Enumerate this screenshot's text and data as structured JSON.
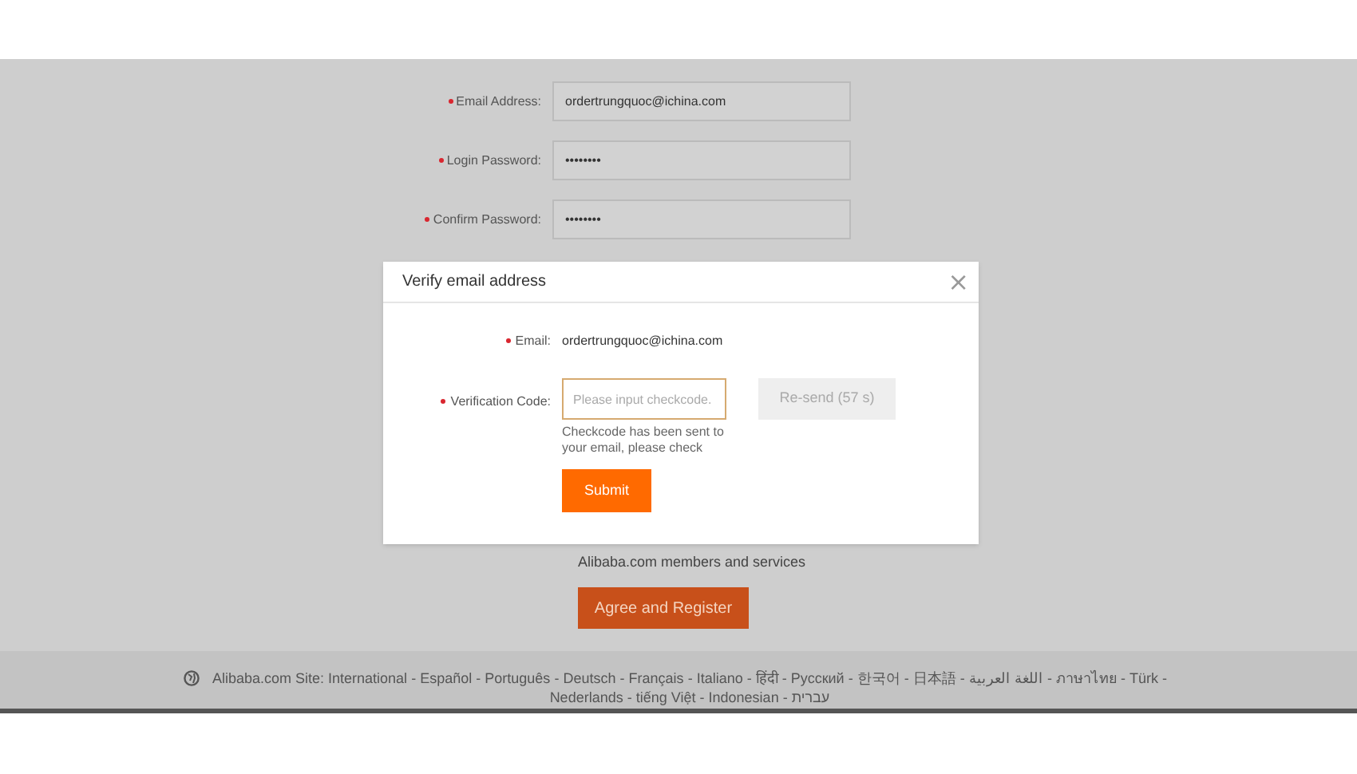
{
  "form": {
    "fields": [
      {
        "label": "Email Address:",
        "required": true,
        "value": "ordertrungquoc@ichina.com"
      },
      {
        "label": "Login Password:",
        "required": true,
        "value": "••••••••"
      },
      {
        "label": "Confirm Password:",
        "required": true,
        "value": "••••••••"
      }
    ],
    "agreement_text": "Alibaba.com members and services",
    "register_button": "Agree and Register"
  },
  "dialog": {
    "title": "Verify email address",
    "close": "×",
    "email": {
      "label": "Email:",
      "required": true,
      "value": "ordertrungquoc@ichina.com"
    },
    "code": {
      "label": "Verification Code:",
      "required": true,
      "placeholder": "Please input checkcode.",
      "hint": "Checkcode has been sent to your email, please check",
      "resend_button": "Re-send (57 s)",
      "resend_disabled": true
    },
    "submit_button": "Submit"
  },
  "footer": {
    "site_label": "Alibaba.com Site:",
    "separator": "-",
    "languages": [
      "International",
      "Español",
      "Português",
      "Deutsch",
      "Français",
      "Italiano",
      "हिंदी",
      "Русский",
      "한국어",
      "日本語",
      "اللغة العربية",
      "ภาษาไทย",
      "Türk",
      "Nederlands",
      "tiếng Việt",
      "Indonesian",
      "עברית"
    ]
  }
}
